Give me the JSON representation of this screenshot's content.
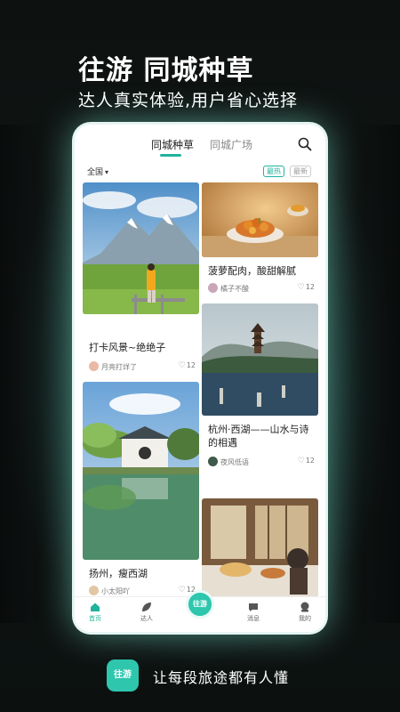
{
  "promo": {
    "headline": "往游 同城种草",
    "subline": "达人真实体验,用户省心选择",
    "footer_text": "让每段旅途都有人懂",
    "footer_logo": "往游"
  },
  "app": {
    "tabs": [
      {
        "label": "同城种草",
        "active": true
      },
      {
        "label": "同城广场",
        "active": false
      }
    ],
    "filter": {
      "label": "全国"
    },
    "sort": [
      {
        "label": "最热",
        "active": true
      },
      {
        "label": "最新",
        "active": false
      }
    ],
    "cards": [
      {
        "title": "打卡风景~绝绝子",
        "author": "月亮打烊了",
        "likes": "12"
      },
      {
        "title": "菠萝配肉，酸甜解腻",
        "author": "橘子不酸",
        "likes": "12"
      },
      {
        "title": "杭州·西湖——山水与诗的相遇",
        "author": "夜风低语",
        "likes": "12"
      },
      {
        "title": "扬州，瘦西湖",
        "author": "小太阳吖",
        "likes": "12"
      }
    ],
    "nav": [
      {
        "label": "首页",
        "active": true
      },
      {
        "label": "达人",
        "active": false
      },
      {
        "label": "往游",
        "active": false
      },
      {
        "label": "消息",
        "active": false
      },
      {
        "label": "我的",
        "active": false
      }
    ]
  },
  "colors": {
    "accent": "#1fb39c",
    "accent_light": "#2ec6ad"
  }
}
